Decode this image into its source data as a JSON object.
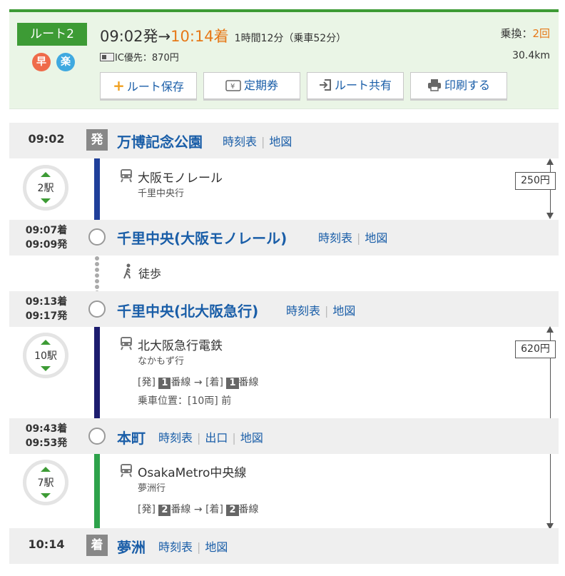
{
  "header": {
    "route_label": "ルート2",
    "badges": [
      "早",
      "楽"
    ],
    "depart_time": "09:02発",
    "arrow": "→",
    "arrive_time": "10:14着",
    "duration": "1時間12分（乗車52分）",
    "ic_fare": "IC優先：870円",
    "transfers_label": "乗換：",
    "transfers_count": "2回",
    "distance": "30.4km",
    "buttons": {
      "save": "ルート保存",
      "pass": "定期券",
      "share": "ルート共有",
      "print": "印刷する"
    }
  },
  "stations": [
    {
      "time": "09:02",
      "marker": "発",
      "name": "万博記念公園",
      "links": [
        "時刻表",
        "地図"
      ]
    },
    {
      "arr": "09:07着",
      "dep": "09:09発",
      "name": "千里中央(大阪モノレール)",
      "links": [
        "時刻表",
        "地図"
      ]
    },
    {
      "arr": "09:13着",
      "dep": "09:17発",
      "name": "千里中央(北大阪急行)",
      "links": [
        "時刻表",
        "地図"
      ]
    },
    {
      "arr": "09:43着",
      "dep": "09:53発",
      "name": "本町",
      "links": [
        "時刻表",
        "出口",
        "地図"
      ]
    },
    {
      "time": "10:14",
      "marker": "着",
      "name": "夢洲",
      "links": [
        "時刻表",
        "地図"
      ]
    }
  ],
  "legs": [
    {
      "stops": "2駅",
      "line": "大阪モノレール",
      "dest": "千里中央行",
      "color": "#1f3f9a",
      "fare": "250円"
    },
    {
      "walk": "徒歩"
    },
    {
      "stops": "10駅",
      "line": "北大阪急行電鉄",
      "dest": "なかもず行",
      "platform": {
        "dep_label": "[発]",
        "dep_num": "1",
        "arr_label": "[着]",
        "arr_num": "1",
        "suffix": "番線",
        "arrow": "→"
      },
      "position": "乗車位置：[10両] 前",
      "color": "#1c1c6e",
      "fare": "620円"
    },
    {
      "stops": "7駅",
      "line": "OsakaMetro中央線",
      "dest": "夢洲行",
      "platform": {
        "dep_label": "[発]",
        "dep_num": "2",
        "arr_label": "[着]",
        "arr_num": "2",
        "suffix": "番線",
        "arrow": "→"
      },
      "color": "#2da24a"
    }
  ]
}
